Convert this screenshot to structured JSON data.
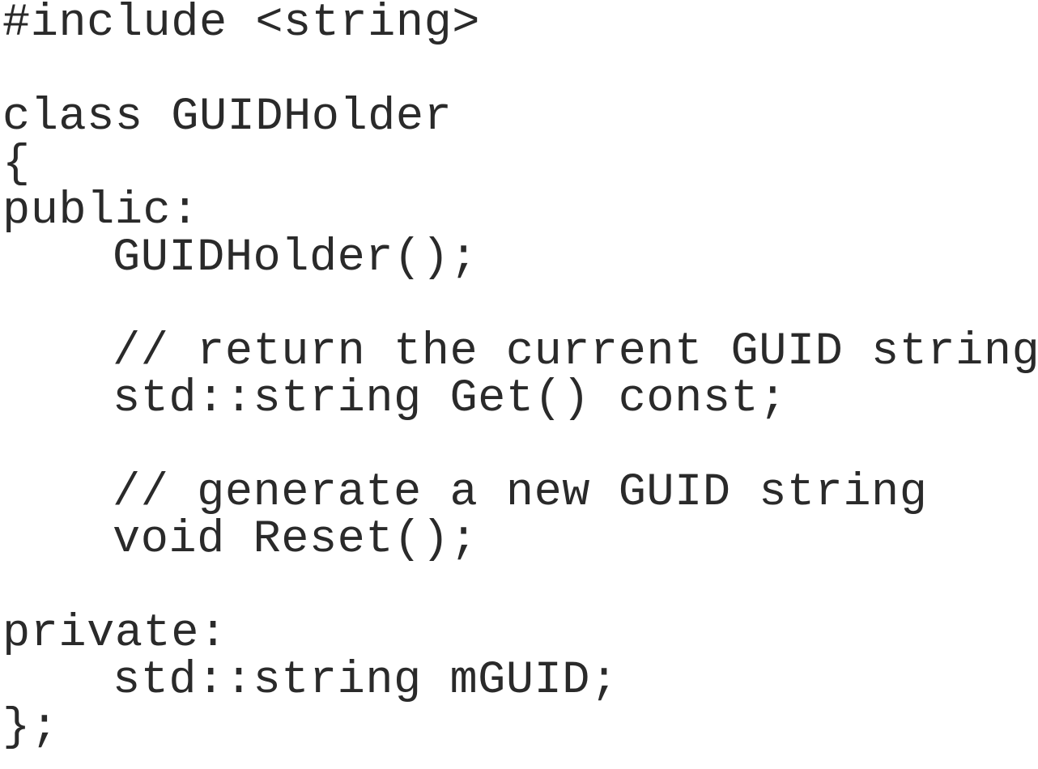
{
  "code": {
    "include": "#include <string>",
    "class_decl": "class GUIDHolder",
    "open_brace": "{",
    "public_label": "public:",
    "constructor": "GUIDHolder();",
    "comment_get": "// return the current GUID string",
    "get_decl": "std::string Get() const;",
    "comment_reset": "// generate a new GUID string",
    "reset_decl": "void Reset();",
    "private_label": "private:",
    "member_decl": "std::string mGUID;",
    "close_brace": "};"
  }
}
